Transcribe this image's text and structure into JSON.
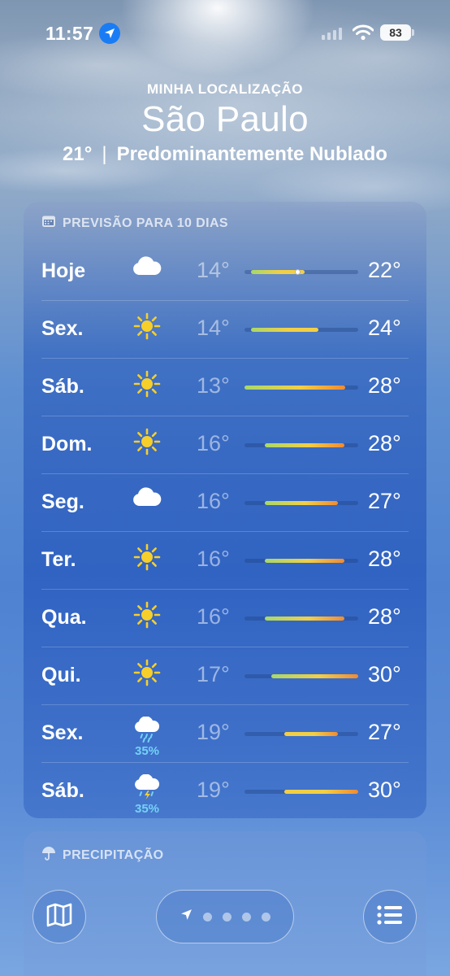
{
  "status": {
    "time": "11:57",
    "battery": "83"
  },
  "header": {
    "subtitle": "MINHA LOCALIZAÇÃO",
    "city": "São Paulo",
    "temp": "21°",
    "separator": "|",
    "condition": "Predominantemente Nublado"
  },
  "forecast": {
    "title": "PREVISÃO PARA 10 DIAS",
    "range": [
      13,
      30
    ],
    "days": [
      {
        "day": "Hoje",
        "icon": "cloud-icon",
        "pop": "",
        "low": "14°",
        "high": "22°",
        "low_v": 14,
        "high_v": 22,
        "current_v": 21
      },
      {
        "day": "Sex.",
        "icon": "sun-icon",
        "pop": "",
        "low": "14°",
        "high": "24°",
        "low_v": 14,
        "high_v": 24
      },
      {
        "day": "Sáb.",
        "icon": "sun-icon",
        "pop": "",
        "low": "13°",
        "high": "28°",
        "low_v": 13,
        "high_v": 28
      },
      {
        "day": "Dom.",
        "icon": "sun-icon",
        "pop": "",
        "low": "16°",
        "high": "28°",
        "low_v": 16,
        "high_v": 28
      },
      {
        "day": "Seg.",
        "icon": "cloud-icon",
        "pop": "",
        "low": "16°",
        "high": "27°",
        "low_v": 16,
        "high_v": 27
      },
      {
        "day": "Ter.",
        "icon": "sun-icon",
        "pop": "",
        "low": "16°",
        "high": "28°",
        "low_v": 16,
        "high_v": 28
      },
      {
        "day": "Qua.",
        "icon": "sun-icon",
        "pop": "",
        "low": "16°",
        "high": "28°",
        "low_v": 16,
        "high_v": 28
      },
      {
        "day": "Qui.",
        "icon": "sun-icon",
        "pop": "",
        "low": "17°",
        "high": "30°",
        "low_v": 17,
        "high_v": 30
      },
      {
        "day": "Sex.",
        "icon": "cloud-rain-icon",
        "pop": "35%",
        "low": "19°",
        "high": "27°",
        "low_v": 19,
        "high_v": 27
      },
      {
        "day": "Sáb.",
        "icon": "cloud-storm-icon",
        "pop": "35%",
        "low": "19°",
        "high": "30°",
        "low_v": 19,
        "high_v": 30
      }
    ]
  },
  "precipitation": {
    "title": "PRECIPITAÇÃO"
  },
  "colors": {
    "bar_cool": "#a8d86a",
    "bar_mid": "#f2cf45",
    "bar_warm": "#f08b34",
    "pop": "#74d2f5"
  }
}
